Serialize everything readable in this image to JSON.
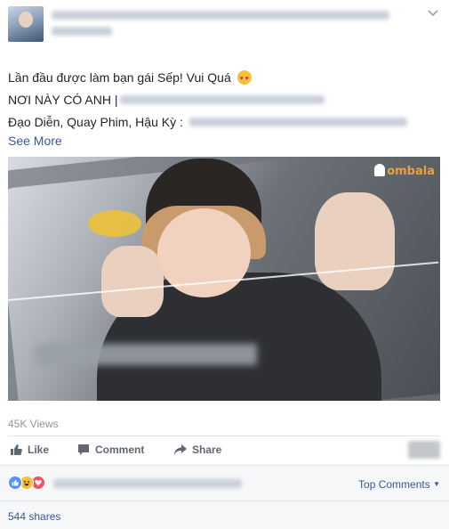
{
  "post": {
    "line1": "Lần đầu được làm bạn gái Sếp! Vui Quá",
    "line2_prefix": "NƠI NÀY CÓ ANH |",
    "line3_prefix": "Đạo Diễn, Quay Phim, Hậu Kỳ :",
    "see_more": "See More",
    "emoji": "heart-eyes-emoji"
  },
  "video": {
    "watermark": "ombala"
  },
  "stats": {
    "views": "45K Views",
    "shares": "544 shares"
  },
  "actions": {
    "like": "Like",
    "comment": "Comment",
    "share": "Share"
  },
  "comments": {
    "sort_label": "Top Comments"
  },
  "colors": {
    "link": "#365899",
    "muted": "#90949c",
    "like_reaction": "#5890ff",
    "haha_reaction": "#f7c03a",
    "love_reaction": "#f25268"
  }
}
